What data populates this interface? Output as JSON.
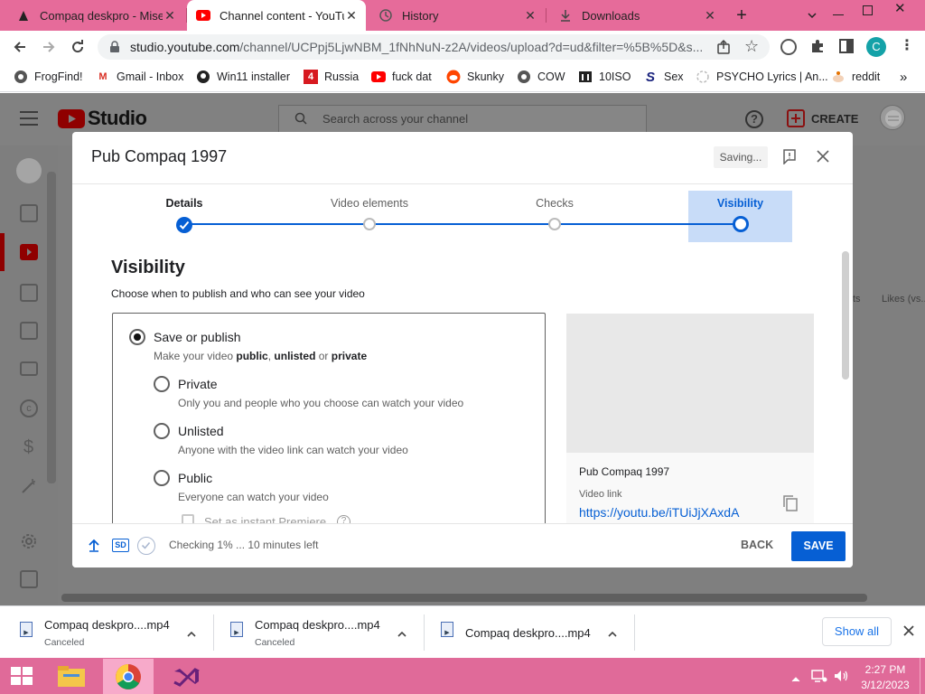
{
  "browser": {
    "tabs": [
      {
        "title": "Compaq deskpro - Mise",
        "close": "✕"
      },
      {
        "title": "Channel content - YouTube",
        "close": "✕"
      },
      {
        "title": "History",
        "close": "✕"
      },
      {
        "title": "Downloads",
        "close": "✕"
      }
    ],
    "url_host": "studio.youtube.com",
    "url_path": "/channel/UCPpj5LjwNBM_1fNhNuN-z2A/videos/upload?d=ud&filter=%5B%5D&s...",
    "profile_initial": "C",
    "bookmarks": [
      "FrogFind!",
      "Gmail - Inbox",
      "Win11 installer",
      "Russia",
      "fuck dat",
      "Skunky",
      "COW",
      "10ISO",
      "Sex",
      "PSYCHO Lyrics | An...",
      "reddit"
    ],
    "bookmarks_more": "»"
  },
  "studio": {
    "logo_text": "Studio",
    "search_placeholder": "Search across your channel",
    "create_label": "CREATE",
    "bg_col1": "ts",
    "bg_col2": "Likes (vs..."
  },
  "dialog": {
    "title": "Pub Compaq 1997",
    "saving_label": "Saving...",
    "steps": [
      "Details",
      "Video elements",
      "Checks",
      "Visibility"
    ],
    "heading": "Visibility",
    "subheading": "Choose when to publish and who can see your video",
    "save_or_publish": {
      "title": "Save or publish",
      "desc_prefix": "Make your video ",
      "desc_public": "public",
      "desc_sep": ", ",
      "desc_unlisted": "unlisted",
      "desc_or": " or ",
      "desc_private": "private"
    },
    "options": [
      {
        "title": "Private",
        "desc": "Only you and people who you choose can watch your video"
      },
      {
        "title": "Unlisted",
        "desc": "Anyone with the video link can watch your video"
      },
      {
        "title": "Public",
        "desc": "Everyone can watch your video"
      }
    ],
    "premiere_label": "Set as instant Premiere",
    "preview": {
      "video_title": "Pub Compaq 1997",
      "link_label": "Video link",
      "link": "https://youtu.be/iTUiJjXAxdA"
    },
    "footer": {
      "sd_badge": "SD",
      "status": "Checking 1% ... 10 minutes left",
      "back": "BACK",
      "save": "SAVE"
    }
  },
  "downloads": {
    "items": [
      {
        "name": "Compaq deskpro....mp4",
        "status": "Canceled"
      },
      {
        "name": "Compaq deskpro....mp4",
        "status": "Canceled"
      },
      {
        "name": "Compaq deskpro....mp4",
        "status": ""
      }
    ],
    "show_all": "Show all"
  },
  "taskbar": {
    "time": "2:27 PM",
    "date": "3/12/2023"
  },
  "colors": {
    "accent_blue": "#065fd4",
    "save_button": "#065fd4",
    "taskbar": "#e06a99",
    "tabstrip": "#e66b9a"
  }
}
